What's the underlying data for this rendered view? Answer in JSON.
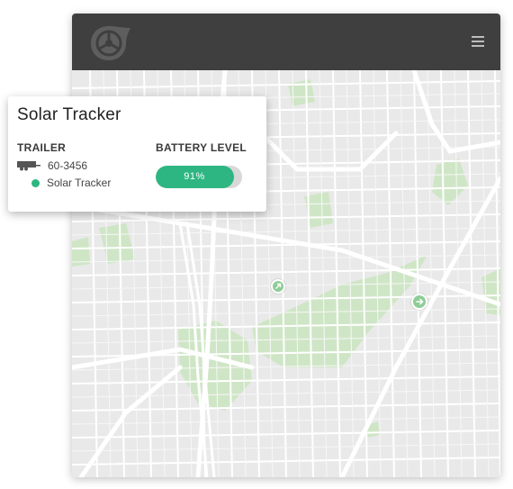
{
  "card": {
    "title": "Solar Tracker",
    "trailer_label": "TRAILER",
    "battery_label": "BATTERY LEVEL",
    "trailer_id": "60-3456",
    "device_name": "Solar Tracker",
    "battery_percent": 91,
    "battery_text": "91%"
  },
  "colors": {
    "topbar": "#3f3f3f",
    "accent_green": "#2db682",
    "map_park": "#cfe6c6",
    "map_base": "#e9e9e9"
  },
  "icons": {
    "logo": "brand-logo-icon",
    "menu": "hamburger-menu-icon",
    "trailer": "trailer-icon",
    "marker": "map-marker-icon"
  }
}
